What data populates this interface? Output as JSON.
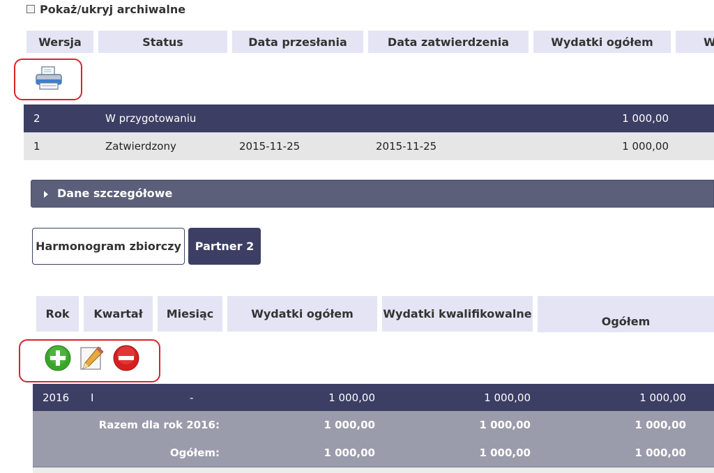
{
  "archive": {
    "label": "Pokaż/ukryj archiwalne"
  },
  "versions": {
    "headers": [
      "Wersja",
      "Status",
      "Data przesłania",
      "Data zatwierdzenia",
      "Wydatki ogółem",
      "W"
    ],
    "rows": [
      {
        "version": "2",
        "status": "W przygotowaniu",
        "sent": "",
        "approved": "",
        "total": "1 000,00"
      },
      {
        "version": "1",
        "status": "Zatwierdzony",
        "sent": "2015-11-25",
        "approved": "2015-11-25",
        "total": "1 000,00"
      }
    ]
  },
  "details": {
    "label": "Dane szczegółowe"
  },
  "tabs": [
    "Harmonogram zbiorczy",
    "Partner 2"
  ],
  "schedule": {
    "headers": [
      "Rok",
      "Kwartał",
      "Miesiąc",
      "Wydatki ogółem",
      "Wydatki kwalifikowalne",
      "Ogółem"
    ],
    "row": {
      "year": "2016",
      "quarter": "I",
      "month": "-",
      "total": "1 000,00",
      "eligible": "1 000,00",
      "overall": "1 000,00"
    },
    "sum_year": {
      "label": "Razem dla rok 2016:",
      "total": "1 000,00",
      "eligible": "1 000,00",
      "overall": "1 000,00"
    },
    "sum_all": {
      "label": "Ogółem:",
      "total": "1 000,00",
      "eligible": "1 000,00",
      "overall": "1 000,00"
    }
  },
  "colors": {
    "accent_dark": "#3d3e64",
    "header_bg": "#e4e4f4",
    "highlight_red": "#d8232a",
    "add_green": "#3aa52a",
    "remove_red": "#d61f1f"
  },
  "icons": {
    "print": "printer-icon",
    "add": "add-icon",
    "edit": "edit-icon",
    "remove": "remove-icon"
  }
}
